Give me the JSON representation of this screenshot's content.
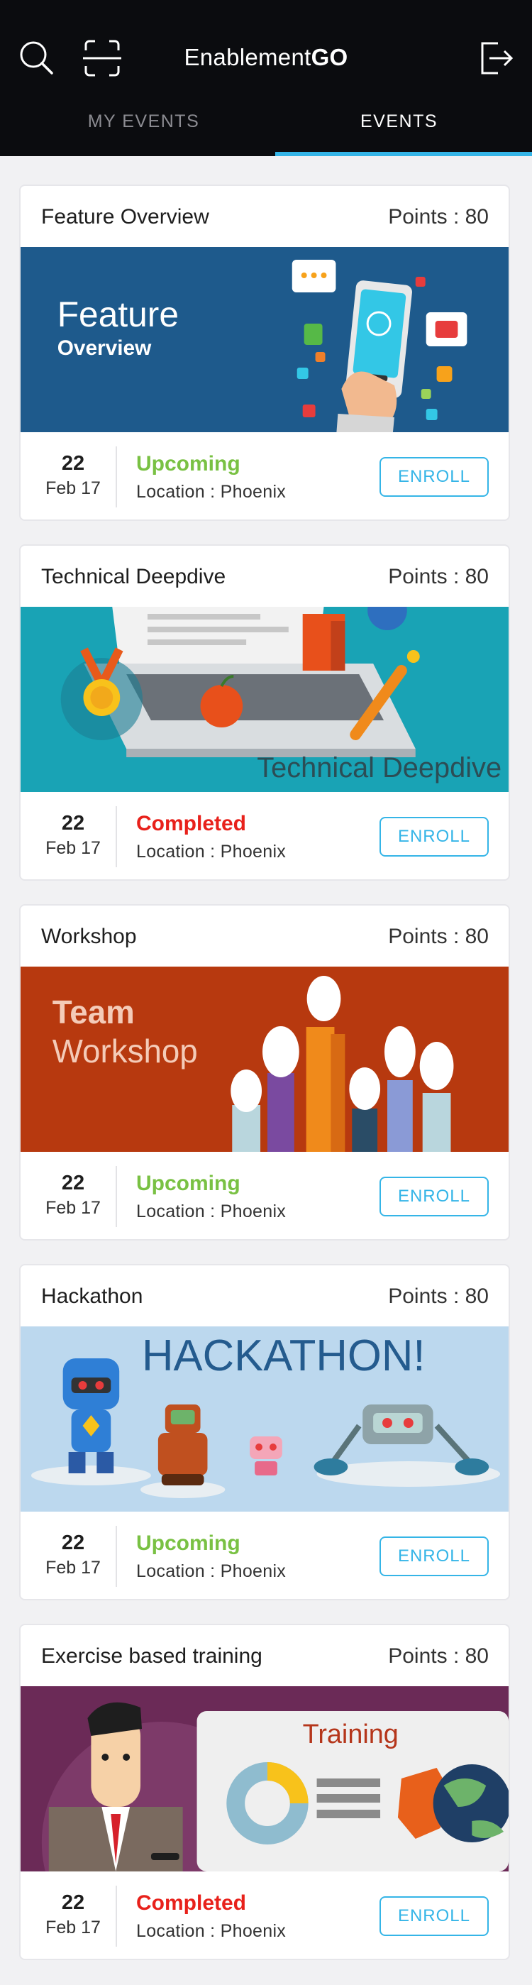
{
  "header": {
    "title_prefix": "Enablement",
    "title_suffix": "GO",
    "tabs": [
      {
        "label": "MY EVENTS",
        "active": false
      },
      {
        "label": "EVENTS",
        "active": true
      }
    ],
    "icons": [
      "search-icon",
      "scan-icon",
      "logout-icon"
    ]
  },
  "colors": {
    "header_bg": "#0b0c0f",
    "accent": "#35b5e7",
    "upcoming": "#79c143",
    "completed": "#e8211b"
  },
  "events": [
    {
      "title": "Feature Overview",
      "points": "Points : 80",
      "banner_text_1": "Feature",
      "banner_text_2": "Overview",
      "day": "22",
      "month": "Feb 17",
      "status": "Upcoming",
      "location": "Location : Phoenix",
      "button": "ENROLL"
    },
    {
      "title": "Technical Deepdive",
      "points": "Points : 80",
      "banner_text_1": "Technical Deepdive",
      "day": "22",
      "month": "Feb 17",
      "status": "Completed",
      "location": "Location : Phoenix",
      "button": "ENROLL"
    },
    {
      "title": "Workshop",
      "points": "Points : 80",
      "banner_text_1": "Team",
      "banner_text_2": "Workshop",
      "day": "22",
      "month": "Feb 17",
      "status": "Upcoming",
      "location": "Location : Phoenix",
      "button": "ENROLL"
    },
    {
      "title": "Hackathon",
      "points": "Points : 80",
      "banner_text_1": "HACKATHON!",
      "day": "22",
      "month": "Feb 17",
      "status": "Upcoming",
      "location": "Location : Phoenix",
      "button": "ENROLL"
    },
    {
      "title": "Exercise based training",
      "points": "Points : 80",
      "banner_text_1": "Training",
      "day": "22",
      "month": "Feb 17",
      "status": "Completed",
      "location": "Location : Phoenix",
      "button": "ENROLL"
    }
  ]
}
